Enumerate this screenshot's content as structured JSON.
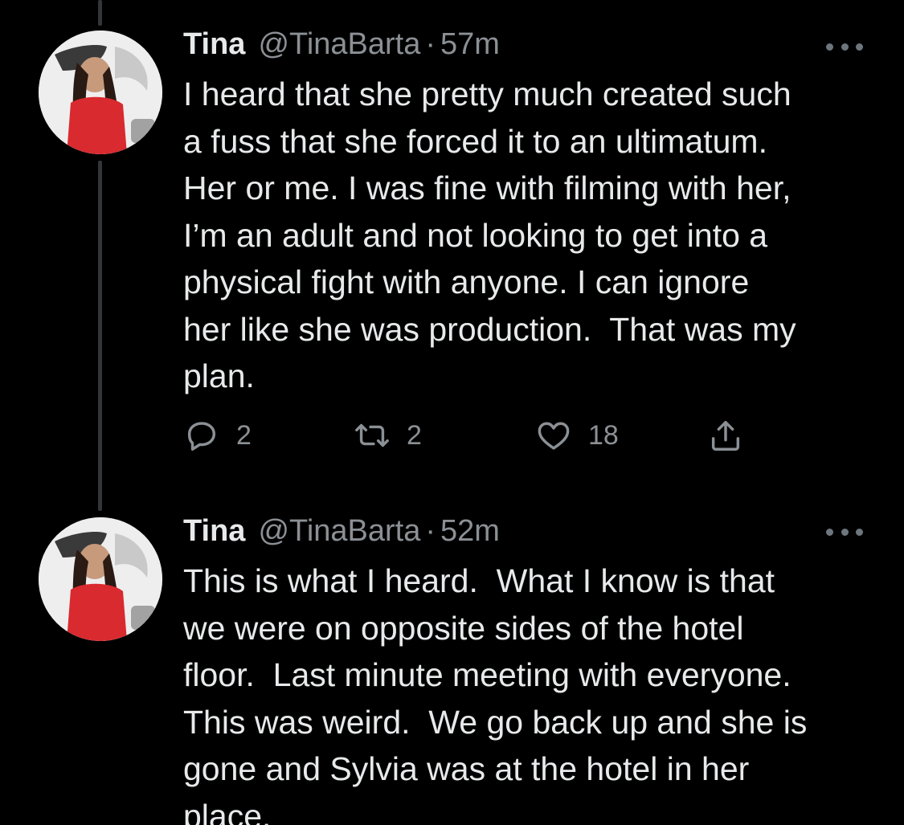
{
  "thread": [
    {
      "author_name": "Tina",
      "handle": "@TinaBarta",
      "separator": "·",
      "time": "57m",
      "text": "I heard that she pretty much created such\na fuss that she forced it to an ultimatum.\nHer or me. I was fine with filming with her,\nI’m an adult and not looking to get into a\nphysical fight with anyone. I can ignore\nher like she was production.  That was my\nplan.",
      "replies": "2",
      "retweets": "2",
      "likes": "18"
    },
    {
      "author_name": "Tina",
      "handle": "@TinaBarta",
      "separator": "·",
      "time": "52m",
      "text": "This is what I heard.  What I know is that\nwe were on opposite sides of the hotel\nfloor.  Last minute meeting with everyone.\nThis was weird.  We go back up and she is\ngone and Sylvia was at the hotel in her\nplace."
    }
  ],
  "icons": {
    "reply": "reply-icon",
    "retweet": "retweet-icon",
    "like": "heart-icon",
    "share": "share-icon",
    "more": "more-icon"
  },
  "colors": {
    "background": "#000000",
    "text": "#e7e9ea",
    "secondary": "#8b9095",
    "thread_line": "#333639"
  }
}
